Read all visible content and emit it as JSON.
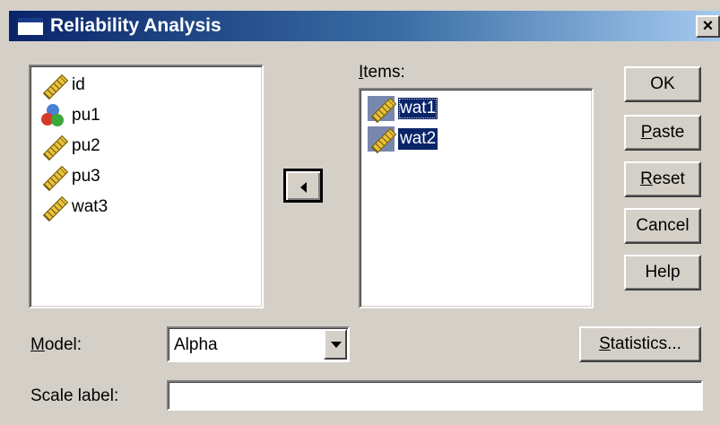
{
  "window": {
    "title": "Reliability Analysis",
    "close_glyph": "×"
  },
  "source_list": {
    "items": [
      {
        "label": "id",
        "icon": "scale-ruler-icon"
      },
      {
        "label": "pu1",
        "icon": "nominal-circles-icon"
      },
      {
        "label": "pu2",
        "icon": "scale-ruler-icon"
      },
      {
        "label": "pu3",
        "icon": "scale-ruler-icon"
      },
      {
        "label": "wat3",
        "icon": "scale-ruler-icon"
      }
    ]
  },
  "transfer_button": {
    "icon": "left-arrow-icon"
  },
  "items_list": {
    "label_mnemonic": "I",
    "label_rest": "tems:",
    "items": [
      {
        "label": "wat1",
        "icon": "scale-ruler-icon",
        "selected": true,
        "focused": true
      },
      {
        "label": "wat2",
        "icon": "scale-ruler-icon",
        "selected": true,
        "focused": false
      }
    ]
  },
  "buttons": {
    "ok": {
      "label": "OK"
    },
    "paste": {
      "mnemonic": "P",
      "rest": "aste"
    },
    "reset": {
      "mnemonic": "R",
      "rest": "eset"
    },
    "cancel": {
      "label": "Cancel"
    },
    "help": {
      "label": "Help"
    },
    "statistics": {
      "mnemonic": "S",
      "rest": "tatistics..."
    }
  },
  "model": {
    "label_mnemonic": "M",
    "label_rest": "odel:",
    "value": "Alpha"
  },
  "scale_label": {
    "label": "Scale label:",
    "value": ""
  },
  "colors": {
    "dialog_bg": "#d4d0c8",
    "title_start": "#0a246a",
    "title_end": "#a6caf0",
    "selection": "#0a246a"
  }
}
